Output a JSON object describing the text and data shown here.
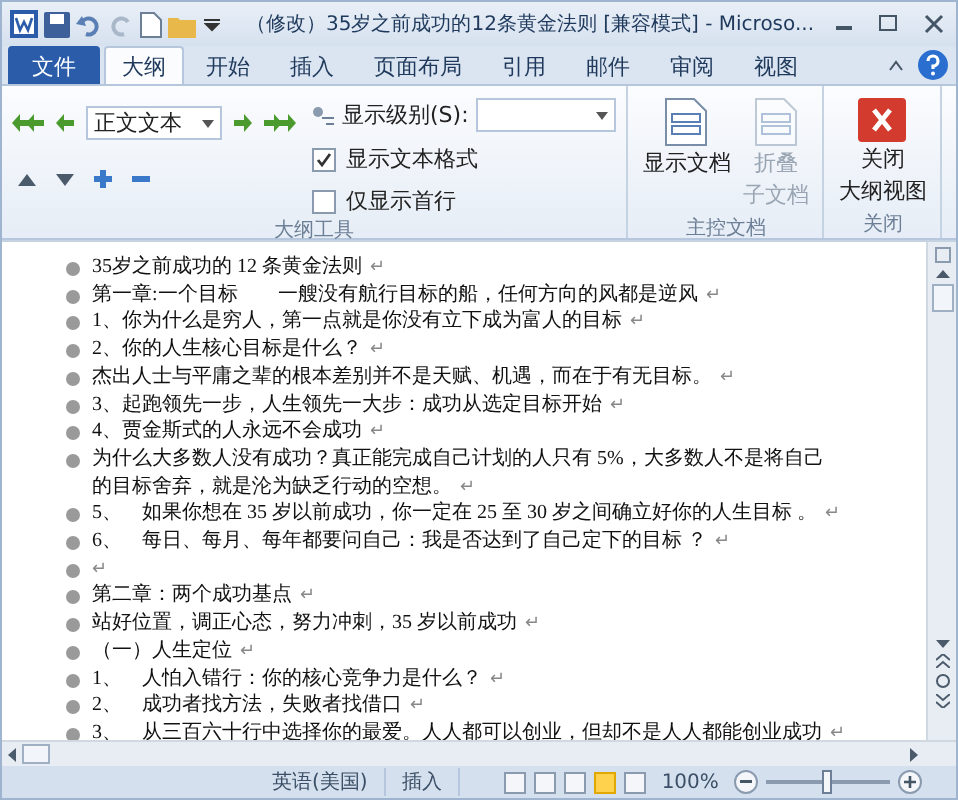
{
  "window": {
    "title": "（修改）35岁之前成功的12条黄金法则 [兼容模式] - Microso..."
  },
  "tabs": [
    {
      "label": "文件",
      "kind": "file",
      "selected": false
    },
    {
      "label": "大纲",
      "kind": "tab",
      "selected": true
    },
    {
      "label": "开始",
      "kind": "tab",
      "selected": false
    },
    {
      "label": "插入",
      "kind": "tab",
      "selected": false
    },
    {
      "label": "页面布局",
      "kind": "tab",
      "selected": false
    },
    {
      "label": "引用",
      "kind": "tab",
      "selected": false
    },
    {
      "label": "邮件",
      "kind": "tab",
      "selected": false
    },
    {
      "label": "审阅",
      "kind": "tab",
      "selected": false
    },
    {
      "label": "视图",
      "kind": "tab",
      "selected": false
    }
  ],
  "outline_tools": {
    "level_value": "正文文本",
    "show_level_label": "显示级别(S):",
    "checks": [
      {
        "label": "显示文本格式",
        "checked": true
      },
      {
        "label": "仅显示首行",
        "checked": false
      }
    ],
    "group_label": "大纲工具"
  },
  "master_document": {
    "buttons": [
      {
        "lines": [
          "显示文档"
        ],
        "disabled": false
      },
      {
        "lines": [
          "折叠",
          "子文档"
        ],
        "disabled": true
      }
    ],
    "group_label": "主控文档"
  },
  "close_group": {
    "lines": [
      "关闭",
      "大纲视图"
    ],
    "group_label": "关闭"
  },
  "document": {
    "paragraphs": [
      {
        "lines": [
          "35岁之前成功的 12 条黄金法则"
        ],
        "mark": "↵"
      },
      {
        "lines": [
          "第一章:一个目标　　一艘没有航行目标的船，任何方向的风都是逆风"
        ],
        "mark": "↵"
      },
      {
        "lines": [
          "1、你为什么是穷人，第一点就是你没有立下成为富人的目标"
        ],
        "mark": "↵"
      },
      {
        "lines": [
          "2、你的人生核心目标是什么？"
        ],
        "mark": "↵"
      },
      {
        "lines": [
          "杰出人士与平庸之辈的根本差别并不是天赋、机遇，而在于有无目标。"
        ],
        "mark": "↵"
      },
      {
        "lines": [
          "3、起跑领先一步，人生领先一大步：成功从选定目标开始"
        ],
        "mark": "↵"
      },
      {
        "lines": [
          "4、贾金斯式的人永远不会成功"
        ],
        "mark": "↵"
      },
      {
        "lines": [
          "为什么大多数人没有成功？真正能完成自己计划的人只有 5%，大多数人不是将自己",
          "的目标舍弃，就是沦为缺乏行动的空想。"
        ],
        "mark": "↵"
      },
      {
        "lines": [
          "5、　如果你想在 35 岁以前成功，你一定在 25 至 30 岁之间确立好你的人生目标 。"
        ],
        "mark": "↵"
      },
      {
        "lines": [
          "6、　每日、每月、每年都要问自己：我是否达到了自己定下的目标 ？"
        ],
        "mark": "↵"
      },
      {
        "mark": "↵"
      },
      {
        "lines": [
          "第二章：两个成功基点"
        ],
        "mark": "↵"
      },
      {
        "lines": [
          "站好位置，调正心态，努力冲刺，35 岁以前成功"
        ],
        "mark": "↵"
      },
      {
        "lines": [
          "（一）人生定位"
        ],
        "mark": "↵"
      },
      {
        "lines": [
          "1、　人怕入错行：你的核心竞争力是什么？"
        ],
        "mark": "↵"
      },
      {
        "lines": [
          "2、　成功者找方法，失败者找借口"
        ],
        "mark": "↵"
      },
      {
        "lines": [
          "3、　从三百六十行中选择你的最爱。人人都可以创业，但却不是人人都能创业成功"
        ],
        "mark": "↵"
      }
    ]
  },
  "status_bar": {
    "language": "英语(美国)",
    "mode": "插入",
    "views": [
      {
        "selected": false
      },
      {
        "selected": false
      },
      {
        "selected": false
      },
      {
        "selected": true
      },
      {
        "selected": false
      }
    ],
    "zoom": "100%",
    "zoom_slider": {
      "level": 0.5
    }
  }
}
